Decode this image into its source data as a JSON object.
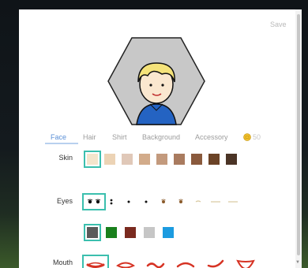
{
  "header": {
    "save_label": "Save"
  },
  "tabs": [
    {
      "label": "Face",
      "active": true
    },
    {
      "label": "Hair",
      "active": false
    },
    {
      "label": "Shirt",
      "active": false
    },
    {
      "label": "Background",
      "active": false
    },
    {
      "label": "Accessory",
      "active": false
    }
  ],
  "coins": {
    "icon": "coin-icon",
    "value": "50"
  },
  "skin": {
    "label": "Skin",
    "colors": [
      "#f4e5cc",
      "#ecd3b5",
      "#e0c8b8",
      "#d2ab8a",
      "#c39a7d",
      "#a97b5f",
      "#8a5a3d",
      "#6b4327",
      "#4b3426"
    ],
    "selected_index": 0
  },
  "eyes": {
    "label": "Eyes",
    "options": [
      "eyes-round",
      "eyes-dot-high",
      "eyes-dot",
      "eyes-small",
      "eyes-brown",
      "eyes-brown-lid",
      "eyes-squint",
      "eyes-closed",
      "eyes-line"
    ],
    "selected_index": 0,
    "colors": [
      "#5a5a5a",
      "#19801c",
      "#7a2a1f",
      "#c6c6c6",
      "#1c9be0"
    ]
  },
  "mouth": {
    "label": "Mouth",
    "options": [
      "mouth-smile",
      "mouth-open",
      "mouth-wave",
      "mouth-frown",
      "mouth-smirk",
      "mouth-grin"
    ],
    "selected_index": 0,
    "color": "#d63324"
  },
  "colors": {
    "accent": "#5a8fd6",
    "selection": "#3bbfae"
  }
}
